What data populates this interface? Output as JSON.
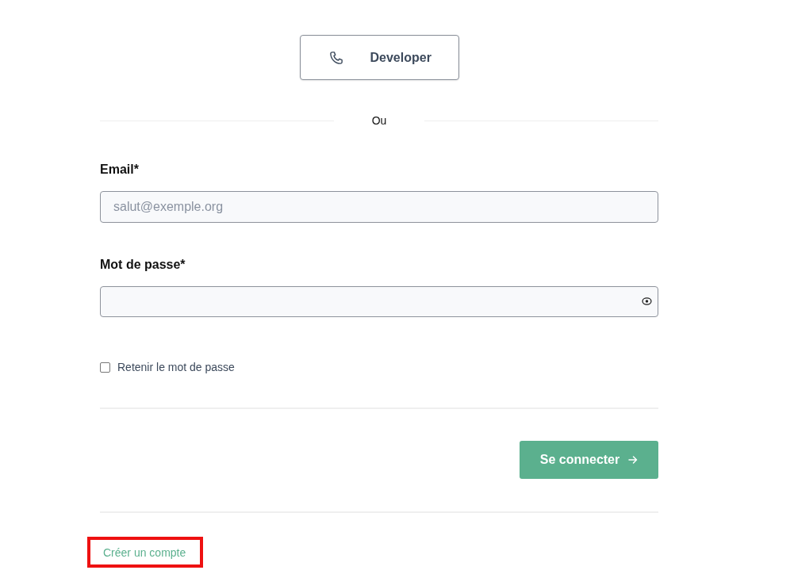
{
  "alt_login_button": {
    "label": "Developer"
  },
  "divider": {
    "label": "Ou"
  },
  "fields": [
    {
      "kind": "email",
      "label": "Email*",
      "placeholder": "salut@exemple.org"
    },
    {
      "kind": "password",
      "label": "Mot de passe*"
    }
  ],
  "remember_me": {
    "label": "Retenir le mot de passe",
    "checked": false
  },
  "submit_button": {
    "label": "Se connecter"
  },
  "create_account_link": {
    "label": "Créer un compte",
    "highlighted": true
  }
}
